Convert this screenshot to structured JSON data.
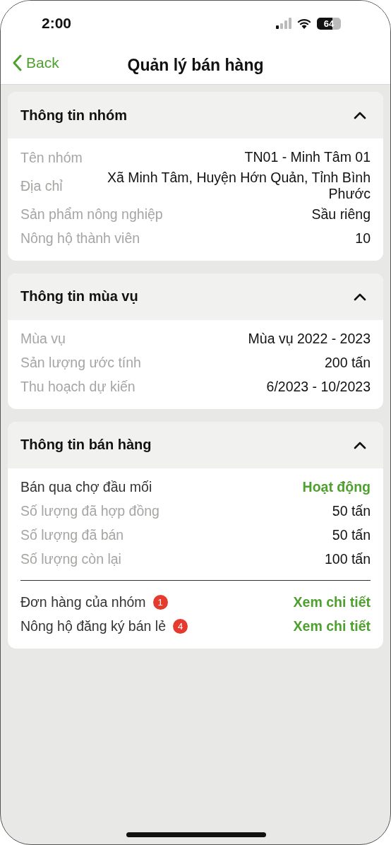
{
  "status_bar": {
    "time": "2:00",
    "battery": "64"
  },
  "nav": {
    "back": "Back",
    "title": "Quản lý bán hàng"
  },
  "sections": [
    {
      "title": "Thông tin nhóm",
      "expanded": true,
      "rows": [
        {
          "kind": "plain",
          "label": "Tên nhóm",
          "value": "TN01 - Minh Tâm 01"
        },
        {
          "kind": "plain",
          "label": "Địa chỉ",
          "value": "Xã Minh Tâm, Huyện Hớn Quản, Tỉnh Bình Phước"
        },
        {
          "kind": "plain",
          "label": "Sản phẩm nông nghiệp",
          "value": "Sầu riêng"
        },
        {
          "kind": "plain",
          "label": "Nông hộ thành viên",
          "value": "10"
        }
      ]
    },
    {
      "title": "Thông tin mùa vụ",
      "expanded": true,
      "rows": [
        {
          "kind": "plain",
          "label": "Mùa vụ",
          "value": "Mùa vụ 2022 - 2023"
        },
        {
          "kind": "plain",
          "label": "Sản lượng ước tính",
          "value": "200 tấn"
        },
        {
          "kind": "plain",
          "label": "Thu hoạch dự kiến",
          "value": "6/2023 - 10/2023"
        }
      ]
    },
    {
      "title": "Thông tin bán hàng",
      "expanded": true,
      "rows": [
        {
          "kind": "status",
          "label": "Bán qua chợ đầu mối",
          "value": "Hoạt động"
        },
        {
          "kind": "plain",
          "label": "Số lượng đã hợp đồng",
          "value": "50 tấn"
        },
        {
          "kind": "plain",
          "label": "Số lượng đã bán",
          "value": "50 tấn"
        },
        {
          "kind": "plain",
          "label": "Số lượng còn lại",
          "value": "100 tấn"
        }
      ],
      "links": [
        {
          "label": "Đơn hàng của nhóm",
          "badge": "1",
          "link": "Xem chi tiết"
        },
        {
          "label": "Nông hộ đăng ký bán lẻ",
          "badge": "4",
          "link": "Xem chi tiết"
        }
      ]
    }
  ]
}
